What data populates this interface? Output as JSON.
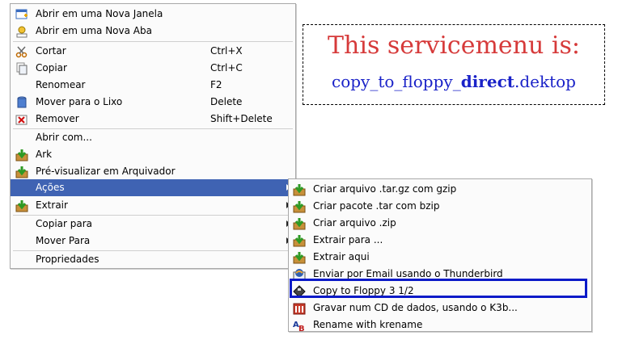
{
  "main_menu": {
    "items": [
      {
        "label": "Abrir em uma Nova Janela",
        "icon": "new-window-icon"
      },
      {
        "label": "Abrir em uma Nova Aba",
        "icon": "new-tab-icon"
      },
      {
        "label": "Cortar",
        "accel": "Ctrl+X",
        "icon": "scissors-icon"
      },
      {
        "label": "Copiar",
        "accel": "Ctrl+C",
        "icon": "copy-icon"
      },
      {
        "label": "Renomear",
        "accel": "F2"
      },
      {
        "label": "Mover para o Lixo",
        "accel": "Delete",
        "icon": "trash-icon"
      },
      {
        "label": "Remover",
        "accel": "Shift+Delete",
        "icon": "delete-icon"
      },
      {
        "label": "Abrir com..."
      },
      {
        "label": "Ark",
        "icon": "ark-icon"
      },
      {
        "label": "Pré-visualizar em Arquivador",
        "icon": "ark-icon"
      },
      {
        "label": "Ações"
      },
      {
        "label": "Extrair",
        "icon": "ark-icon"
      },
      {
        "label": "Copiar para"
      },
      {
        "label": "Mover Para"
      },
      {
        "label": "Propriedades"
      }
    ]
  },
  "sub_menu": {
    "items": [
      {
        "label": "Criar arquivo .tar.gz com gzip",
        "icon": "ark-icon"
      },
      {
        "label": "Criar pacote .tar com bzip",
        "icon": "ark-icon"
      },
      {
        "label": "Criar arquivo .zip",
        "icon": "ark-icon"
      },
      {
        "label": "Extrair para ...",
        "icon": "ark-icon"
      },
      {
        "label": "Extrair aqui",
        "icon": "ark-icon"
      },
      {
        "label": "Enviar por Email usando o Thunderbird",
        "icon": "thunderbird-icon"
      },
      {
        "label": "Copy to Floppy 3 1/2",
        "icon": "floppy-icon"
      },
      {
        "label": "Gravar num CD de dados, usando o K3b...",
        "icon": "k3b-icon"
      },
      {
        "label": "Rename with krename",
        "icon": "krename-icon"
      }
    ]
  },
  "annotation": {
    "title": "This servicemenu is:",
    "file_prefix": "copy_to_floppy_",
    "file_bold": "direct",
    "file_suffix": ".dektop"
  },
  "colors": {
    "highlight": "#3f63b3",
    "focus_box": "#0b1ac8",
    "title": "#d63a3a",
    "file": "#1a22c8"
  }
}
